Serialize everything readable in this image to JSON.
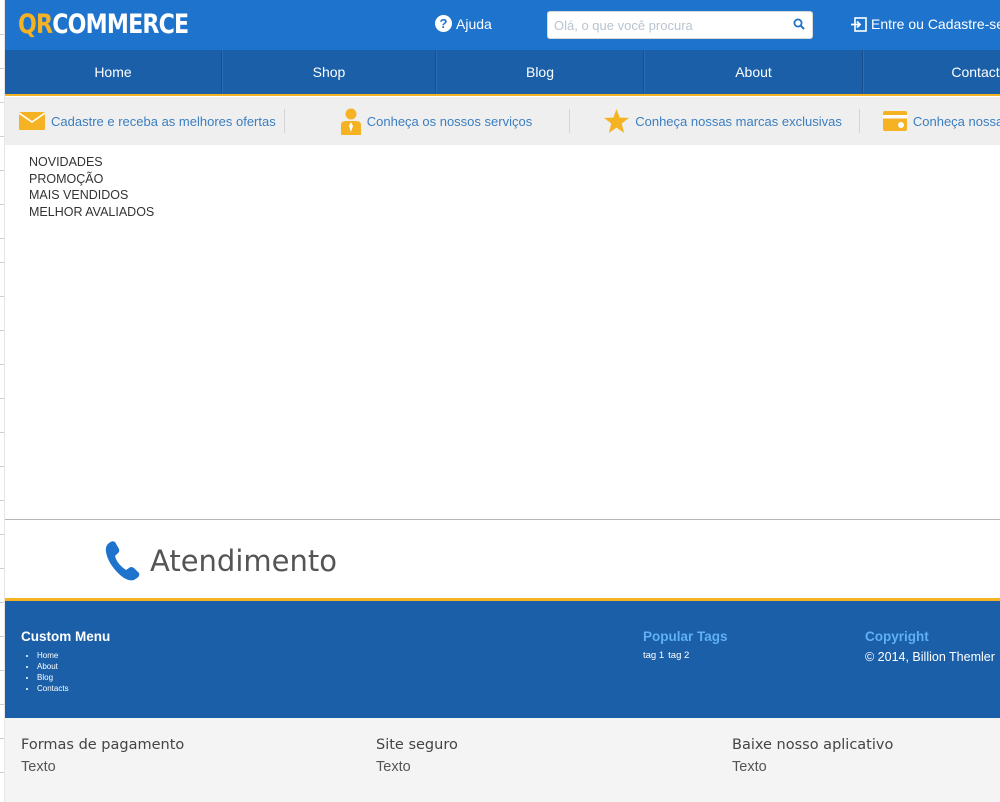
{
  "header": {
    "logo_qr": "QR",
    "logo_commerce": "COMMERCE",
    "help_label": "Ajuda",
    "search_placeholder": "Olá, o que você procura",
    "login_label": "Entre ou Cadastre-se"
  },
  "nav": {
    "items": [
      {
        "label": "Home"
      },
      {
        "label": "Shop"
      },
      {
        "label": "Blog"
      },
      {
        "label": "About"
      },
      {
        "label": "Contacts"
      }
    ]
  },
  "promo": {
    "items": [
      {
        "label": "Cadastre e receba as melhores ofertas",
        "icon": "envelope-icon"
      },
      {
        "label": "Conheça os nossos serviços",
        "icon": "attendant-icon"
      },
      {
        "label": "Conheça nossas marcas exclusivas",
        "icon": "star-icon"
      },
      {
        "label": "Conheça nossas formas",
        "icon": "card-icon"
      }
    ]
  },
  "categories": [
    "NOVIDADES",
    "PROMOÇÃO",
    "MAIS VENDIDOS",
    "MELHOR AVALIADOS"
  ],
  "support": {
    "title": "Atendimento",
    "icon": "phone-icon"
  },
  "footer": {
    "custom_menu_title": "Custom Menu",
    "custom_menu": [
      "Home",
      "About",
      "Blog",
      "Contacts"
    ],
    "tags_title": "Popular Tags",
    "tags": [
      "tag 1",
      "tag 2"
    ],
    "copyright_title": "Copyright",
    "copyright_text": "© 2014, Billion Themler"
  },
  "bottom": {
    "payment_title": "Formas de pagamento",
    "payment_text": "Texto",
    "secure_title": "Site seguro",
    "secure_text": "Texto",
    "app_title": "Baixe nosso aplicativo",
    "app_text": "Texto"
  },
  "colors": {
    "header_blue": "#1e73cd",
    "nav_blue": "#1a5fa8",
    "accent_yellow": "#f5b324",
    "link_blue": "#3b7ec1",
    "footer_heading_blue": "#5fb0f5"
  }
}
